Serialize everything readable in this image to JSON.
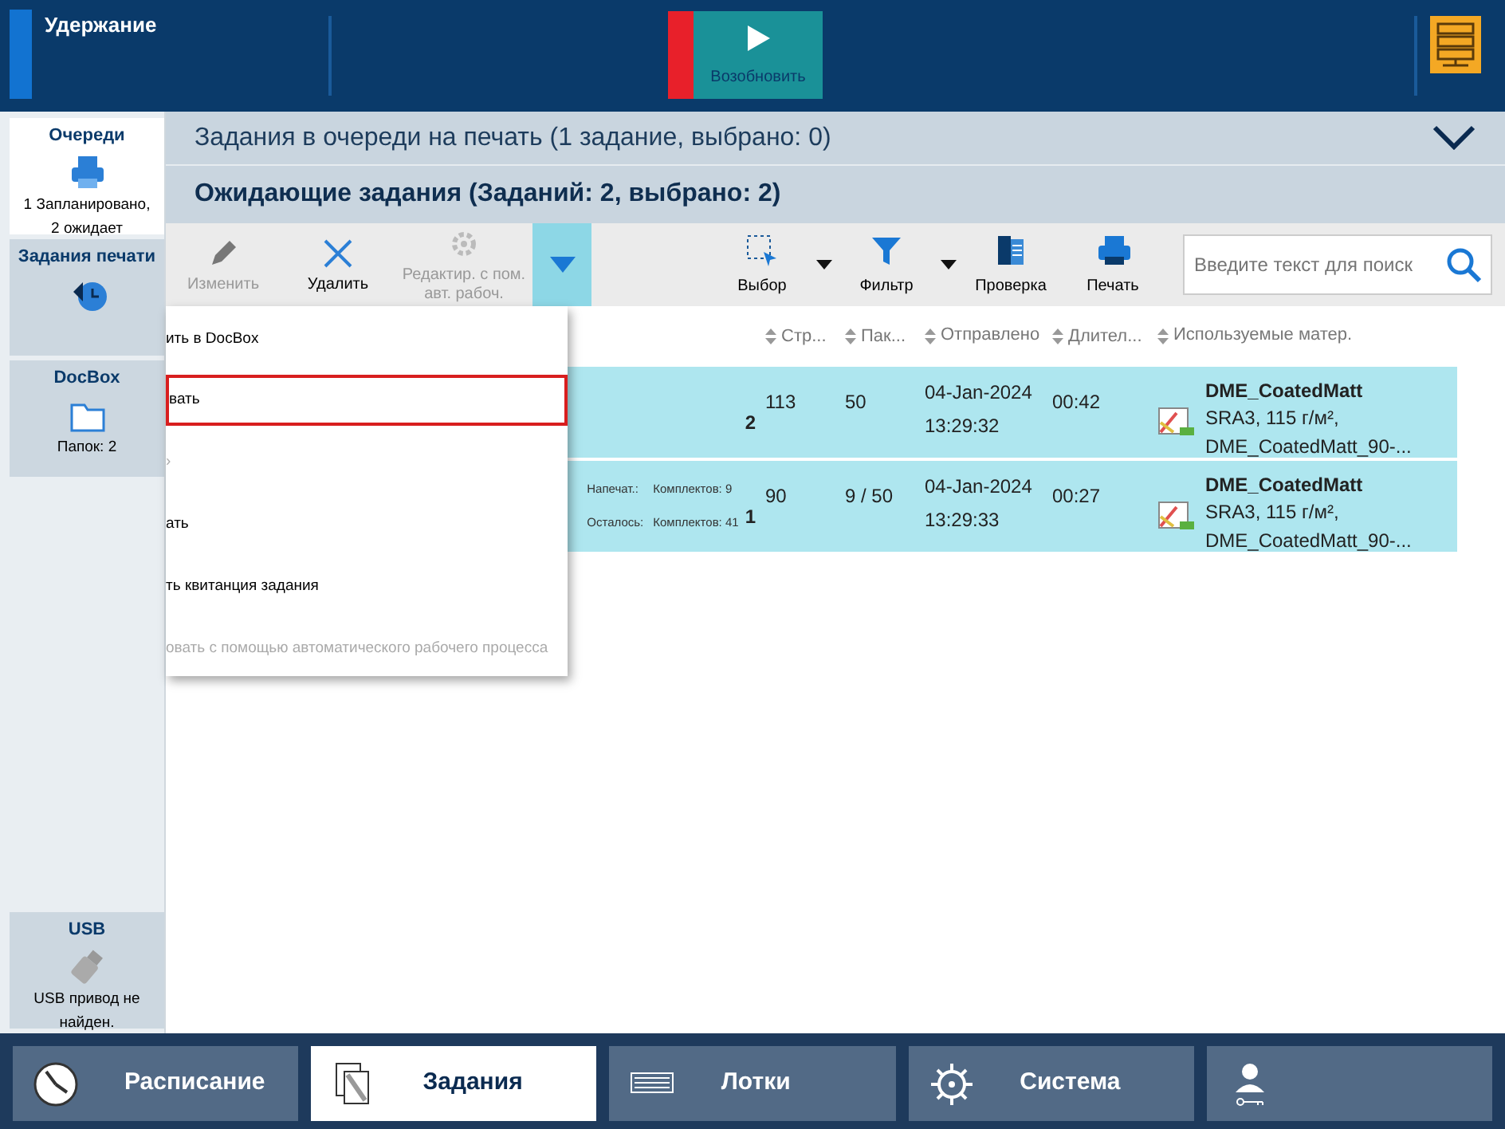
{
  "top_bar": {
    "status": "Удержание",
    "resume_button": "Возобновить"
  },
  "sidebar": [
    {
      "kind": "queues",
      "title": "Очереди",
      "lines": [
        "1 Запланировано,",
        "2 ожидает"
      ],
      "selected": true
    },
    {
      "kind": "print_jobs",
      "title": "Задания печати",
      "selected": false
    },
    {
      "kind": "docbox",
      "title": "DocBox",
      "lines": [
        "Папок: 2"
      ],
      "selected": false
    },
    {
      "kind": "usb",
      "title": "USB",
      "lines": [
        "USB привод не",
        "найден."
      ],
      "selected": false
    }
  ],
  "section_title": "Задания в очереди на печать (1 задание, выбрано: 0)",
  "subsection_title": "Ожидающие задания (Заданий: 2, выбрано: 2)",
  "toolbar": {
    "actions": [
      {
        "kind": "pencil",
        "label": "Изменить",
        "disabled": true
      },
      {
        "kind": "cross",
        "label": "Удалить",
        "disabled": false
      },
      {
        "kind": "gear",
        "label": "Редактир. с пом. авт. рабоч.",
        "disabled": true
      }
    ],
    "more_expanded": true,
    "tools": [
      {
        "kind": "select",
        "label": "Выбор",
        "has_menu": true
      },
      {
        "kind": "filter",
        "label": "Фильтр",
        "has_menu": true
      },
      {
        "kind": "preview",
        "label": "Проверка",
        "has_menu": false
      },
      {
        "kind": "print",
        "label": "Печать",
        "has_menu": false
      }
    ],
    "search": {
      "placeholder": "Введите текст для поиск"
    }
  },
  "table": {
    "columns": [
      "Стр...",
      "Пак...",
      "Отправлено",
      "Длител...",
      "Используемые матер."
    ],
    "rows": [
      {
        "selected": true,
        "copies": "2",
        "pages": "113",
        "sets": "50",
        "sent_date": "04-Jan-2024",
        "sent_time": "13:29:32",
        "duration": "00:42",
        "media_name": "DME_CoatedMatt",
        "media_details": "SRA3, 115 г/м²,",
        "media_extra": "DME_CoatedMatt_90-..."
      },
      {
        "selected": true,
        "printed_label": "Напечат.:",
        "printed": "Комплектов: 9",
        "remaining_label": "Осталось:",
        "remaining": "Комплектов: 41",
        "copies": "1",
        "pages": "90",
        "sets": "9 / 50",
        "sent_date": "04-Jan-2024",
        "sent_time": "13:29:33",
        "duration": "00:27",
        "media_name": "DME_CoatedMatt",
        "media_details": "SRA3, 115 г/м²,",
        "media_extra": "DME_CoatedMatt_90-..."
      }
    ]
  },
  "menu": [
    {
      "label": "ить в DocBox",
      "disabled": false,
      "selected": false
    },
    {
      "label": "вать",
      "disabled": false,
      "selected": true
    },
    {
      "label": "›",
      "disabled": true,
      "selected": false
    },
    {
      "label": "ать",
      "disabled": false,
      "selected": false
    },
    {
      "label": "ть квитанция задания",
      "disabled": false,
      "selected": false
    },
    {
      "label": "овать с помощью автоматического рабочего процесса",
      "disabled": true,
      "selected": false
    }
  ],
  "bottom_tabs": [
    {
      "kind": "clock",
      "label": "Расписание",
      "selected": false
    },
    {
      "kind": "jobs",
      "label": "Задания",
      "selected": true
    },
    {
      "kind": "trays",
      "label": "Лотки",
      "selected": false
    },
    {
      "kind": "system",
      "label": "Система",
      "selected": false
    },
    {
      "kind": "user",
      "selected": false
    }
  ]
}
